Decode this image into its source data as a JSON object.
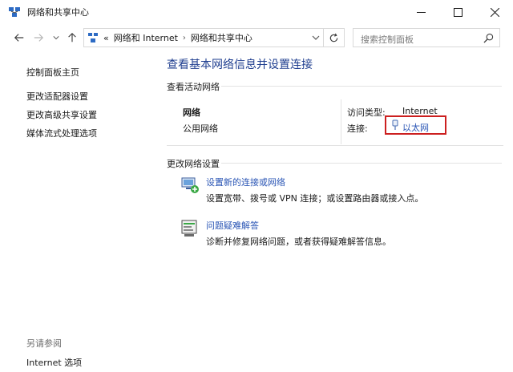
{
  "window": {
    "title": "网络和共享中心",
    "icon": "network-center-icon"
  },
  "nav": {
    "breadcrumb": [
      "«",
      "网络和 Internet",
      "网络和共享中心"
    ],
    "search_placeholder": "搜索控制面板"
  },
  "sidebar": {
    "items": [
      {
        "label": "控制面板主页"
      },
      {
        "label": "更改适配器设置"
      },
      {
        "label": "更改高级共享设置"
      },
      {
        "label": "媒体流式处理选项"
      }
    ],
    "see_also_heading": "另请参阅",
    "see_also": [
      {
        "label": "Internet 选项"
      }
    ]
  },
  "main": {
    "title": "查看基本网络信息并设置连接",
    "active_networks_heading": "查看活动网络",
    "network": {
      "name": "网络",
      "profile": "公用网络",
      "access_type_label": "访问类型:",
      "access_type_value": "Internet",
      "connections_label": "连接:",
      "connection_name": "以太网"
    },
    "change_settings_heading": "更改网络设置",
    "tasks": [
      {
        "link": "设置新的连接或网络",
        "desc": "设置宽带、拨号或 VPN 连接；或设置路由器或接入点。",
        "icon": "new-connection-icon"
      },
      {
        "link": "问题疑难解答",
        "desc": "诊断并修复网络问题，或者获得疑难解答信息。",
        "icon": "troubleshoot-icon"
      }
    ]
  },
  "colors": {
    "link": "#2b56b5",
    "title": "#1e3d8f",
    "highlight_box": "#cc1f1f"
  }
}
